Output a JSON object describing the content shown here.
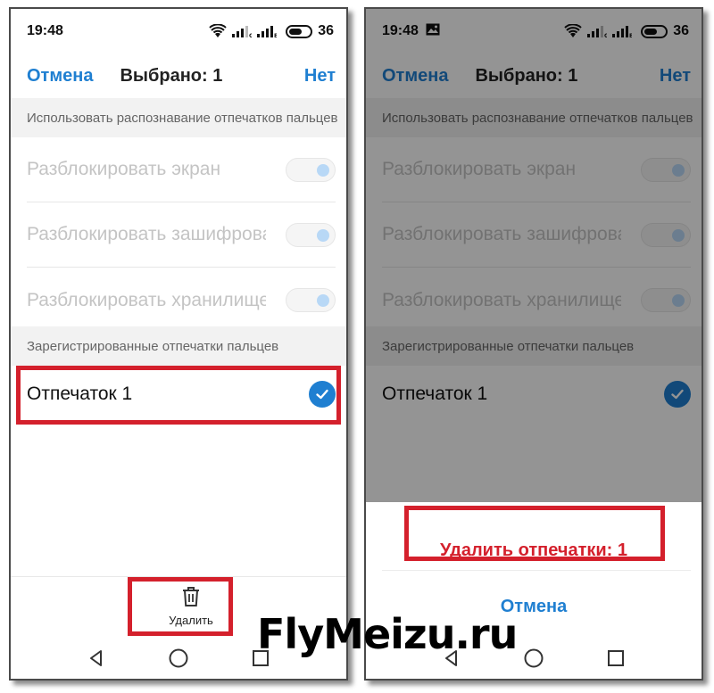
{
  "status_left": {
    "time": "19:48",
    "battery": "36"
  },
  "status_right": {
    "time": "19:48",
    "battery": "36"
  },
  "header": {
    "cancel_label": "Отмена",
    "selected_label": "Выбрано: 1",
    "none_label": "Нет"
  },
  "sections": {
    "usage": "Использовать распознавание отпечатков пальцев",
    "registered": "Зарегистрированные отпечатки пальцев"
  },
  "settings": [
    {
      "label": "Разблокировать экран",
      "enabled": true
    },
    {
      "label": "Разблокировать зашифрованные данные",
      "enabled": true
    },
    {
      "label": "Разблокировать хранилище",
      "enabled": true
    }
  ],
  "fingerprints": [
    {
      "label": "Отпечаток 1",
      "selected": true
    }
  ],
  "toolbar": {
    "delete_label": "Удалить",
    "delete_icon": "trash-icon"
  },
  "sheet": {
    "delete_label": "Удалить отпечатки: 1",
    "cancel_label": "Отмена"
  },
  "watermark": "FlyMeizu.ru",
  "colors": {
    "accent": "#1f7fd1",
    "danger": "#d4202c",
    "highlight": "#d4202c",
    "toggle_knob": "#b8d8f6"
  }
}
